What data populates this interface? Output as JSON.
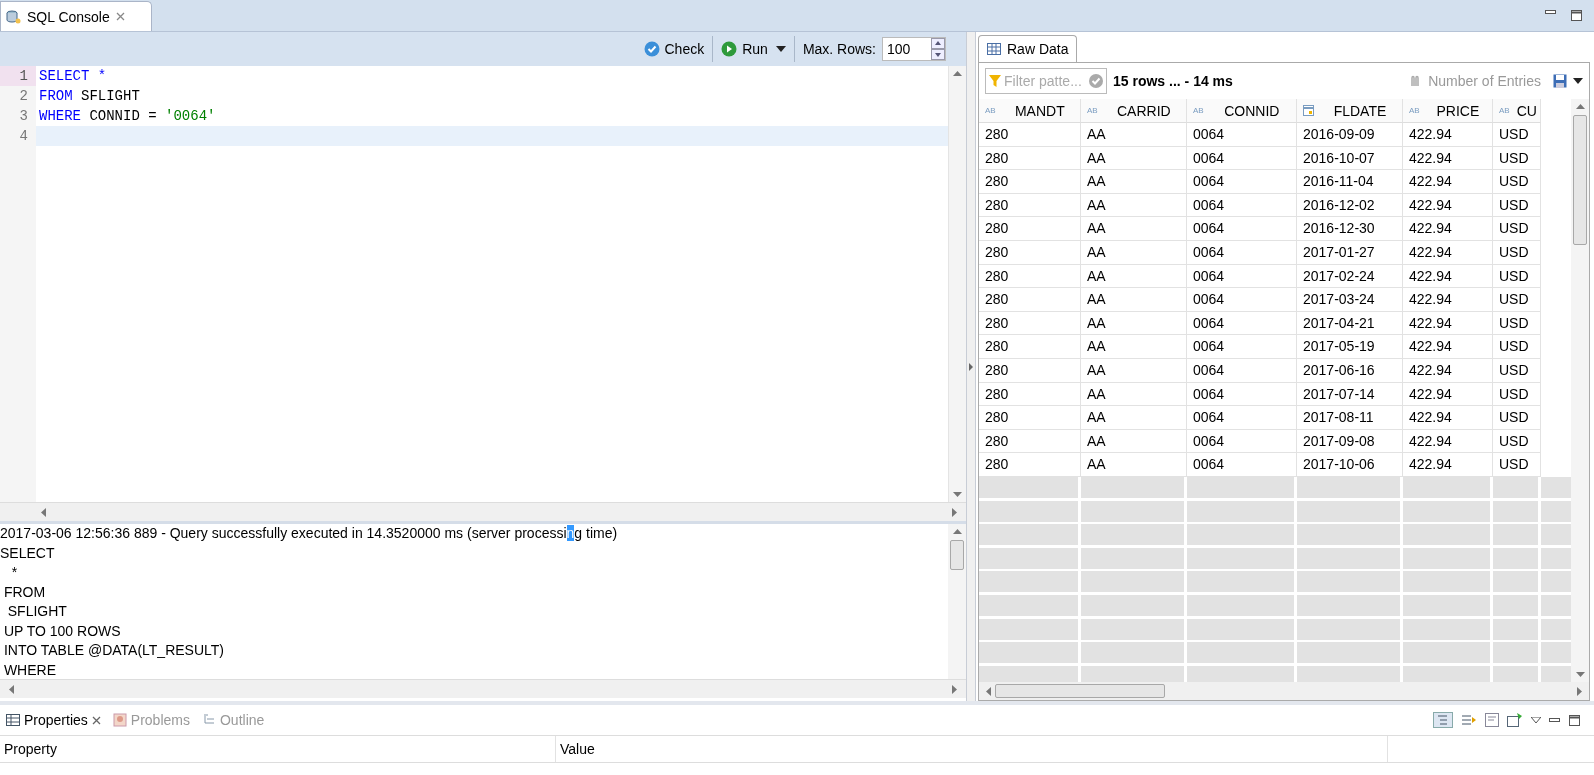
{
  "editor_tab": {
    "label": "SQL Console",
    "selected": true
  },
  "toolbar": {
    "check": "Check",
    "run": "Run",
    "max_rows_label": "Max. Rows:",
    "max_rows": "100"
  },
  "code_lines": [
    {
      "number": "1",
      "current": false,
      "marked": true,
      "tokens": [
        {
          "text": "SELECT *",
          "kind": "keyword"
        }
      ]
    },
    {
      "number": "2",
      "current": false,
      "marked": false,
      "tokens": [
        {
          "text": "FROM",
          "kind": "keyword"
        },
        {
          "text": " SFLIGHT",
          "kind": "plain"
        }
      ]
    },
    {
      "number": "3",
      "current": false,
      "marked": false,
      "tokens": [
        {
          "text": "WHERE",
          "kind": "keyword"
        },
        {
          "text": " CONNID = ",
          "kind": "plain"
        },
        {
          "text": "'0064'",
          "kind": "string"
        }
      ]
    },
    {
      "number": "4",
      "current": true,
      "marked": false
    }
  ],
  "console_lines": [
    {
      "before": "2017-03-06 12:56:36 889 - Query successfully executed in 14.3520000 ms (server processi",
      "selected_text": "n",
      "after": "g time)"
    },
    {
      "before": "SELECT"
    },
    {
      "before": "   *"
    },
    {
      "before": " FROM"
    },
    {
      "before": "  SFLIGHT"
    },
    {
      "before": " UP TO 100 ROWS"
    },
    {
      "before": " INTO TABLE @DATA(LT_RESULT)"
    },
    {
      "before": " WHERE"
    }
  ],
  "result_tab": {
    "label": "Raw Data",
    "selected": true
  },
  "filter": {
    "placeholder": "Filter patte..."
  },
  "summary": "15 rows ... - 14 ms",
  "number_of_entries": {
    "label": "Number of Entries",
    "disabled": true
  },
  "table": {
    "columns": [
      {
        "label": "MANDT",
        "kind": "text",
        "type_label": "AB"
      },
      {
        "label": "CARRID",
        "kind": "text",
        "type_label": "AB"
      },
      {
        "label": "CONNID",
        "kind": "text",
        "type_label": "AB"
      },
      {
        "label": "FLDATE",
        "kind": "date"
      },
      {
        "label": "PRICE",
        "kind": "text",
        "type_label": "AB"
      },
      {
        "label": "CU",
        "kind": "text",
        "type_label": "AB"
      }
    ],
    "rows": [
      [
        "280",
        "AA",
        "0064",
        "2016-09-09",
        "422.94",
        "USD"
      ],
      [
        "280",
        "AA",
        "0064",
        "2016-10-07",
        "422.94",
        "USD"
      ],
      [
        "280",
        "AA",
        "0064",
        "2016-11-04",
        "422.94",
        "USD"
      ],
      [
        "280",
        "AA",
        "0064",
        "2016-12-02",
        "422.94",
        "USD"
      ],
      [
        "280",
        "AA",
        "0064",
        "2016-12-30",
        "422.94",
        "USD"
      ],
      [
        "280",
        "AA",
        "0064",
        "2017-01-27",
        "422.94",
        "USD"
      ],
      [
        "280",
        "AA",
        "0064",
        "2017-02-24",
        "422.94",
        "USD"
      ],
      [
        "280",
        "AA",
        "0064",
        "2017-03-24",
        "422.94",
        "USD"
      ],
      [
        "280",
        "AA",
        "0064",
        "2017-04-21",
        "422.94",
        "USD"
      ],
      [
        "280",
        "AA",
        "0064",
        "2017-05-19",
        "422.94",
        "USD"
      ],
      [
        "280",
        "AA",
        "0064",
        "2017-06-16",
        "422.94",
        "USD"
      ],
      [
        "280",
        "AA",
        "0064",
        "2017-07-14",
        "422.94",
        "USD"
      ],
      [
        "280",
        "AA",
        "0064",
        "2017-08-11",
        "422.94",
        "USD"
      ],
      [
        "280",
        "AA",
        "0064",
        "2017-09-08",
        "422.94",
        "USD"
      ],
      [
        "280",
        "AA",
        "0064",
        "2017-10-06",
        "422.94",
        "USD"
      ]
    ]
  },
  "bottom_tabs": [
    {
      "label": "Properties",
      "selected": true,
      "kind": "properties"
    },
    {
      "label": "Problems",
      "selected": false,
      "kind": "problems"
    },
    {
      "label": "Outline",
      "selected": false,
      "kind": "outline"
    }
  ],
  "properties_columns": [
    "Property",
    "Value"
  ]
}
